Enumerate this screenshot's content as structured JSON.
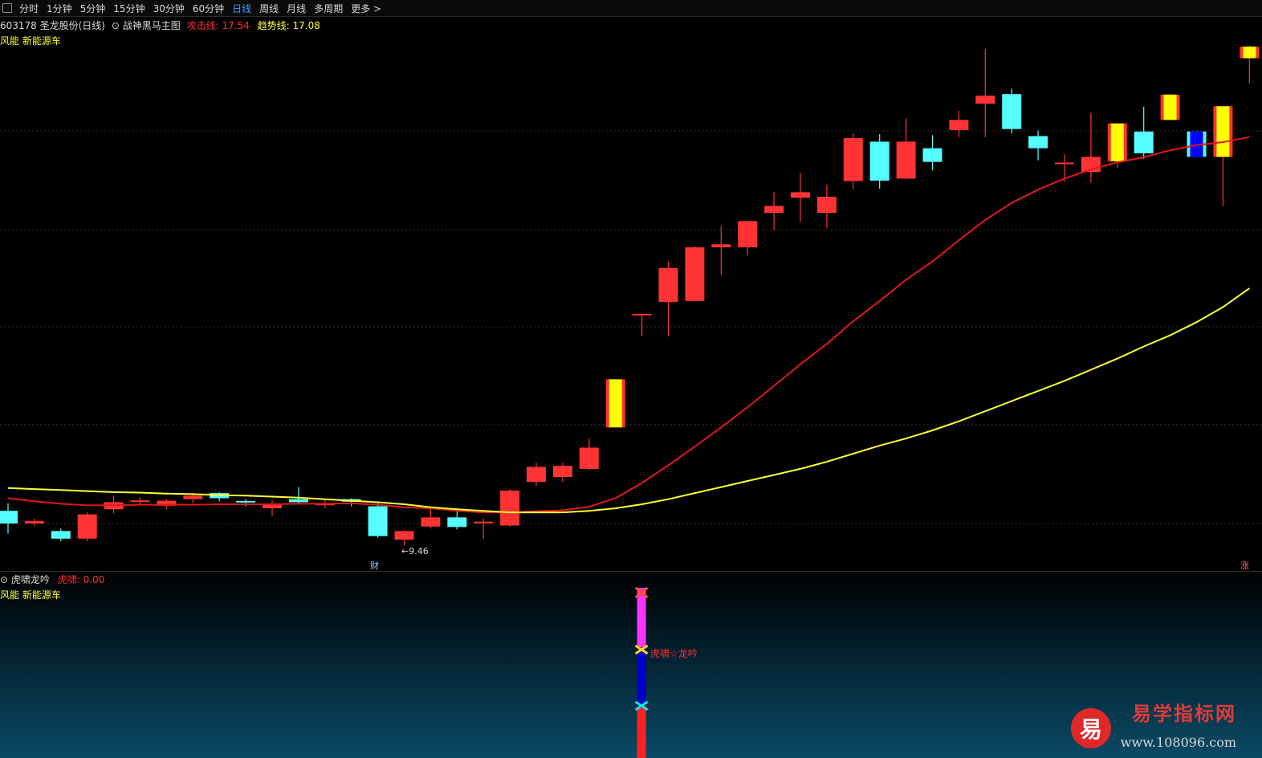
{
  "toolbar": {
    "tabs": [
      "分时",
      "1分钟",
      "5分钟",
      "15分钟",
      "30分钟",
      "60分钟",
      "日线",
      "周线",
      "月线",
      "多周期",
      "更多 >"
    ],
    "active": "日线"
  },
  "main": {
    "stock": "603178 圣龙股份(日线)",
    "indicator": "战神黑马主图",
    "attack_label": "攻击线:",
    "attack_value": "17.54",
    "trend_label": "趋势线:",
    "trend_value": "17.08",
    "concepts": "风能 新能源车",
    "low_mark": "←9.46",
    "cai_badge": "财",
    "zhang_badge": "涨"
  },
  "sub": {
    "indicator": "虎啸龙吟",
    "value_label": "虎啸:",
    "value": "0.00",
    "concepts": "风能 新能源车",
    "signal_text": "虎啸☆龙吟"
  },
  "watermark": {
    "name": "易学指标网",
    "url": "www.108096.com",
    "logo_char": "易"
  },
  "colors": {
    "up": "#ff3333",
    "down": "#55ffff",
    "attack_line": "#e01818",
    "trend_line": "#ffff33",
    "special": "#ffff00",
    "blue": "#0000ff",
    "active_tab": "#3ea1ff"
  },
  "chart_data": {
    "type": "candlestick",
    "note_price_low": 9.46,
    "candles": [
      {
        "o": 10.15,
        "c": 9.9,
        "h": 10.3,
        "l": 9.7
      },
      {
        "o": 9.9,
        "c": 9.95,
        "h": 10.0,
        "l": 9.85
      },
      {
        "o": 9.75,
        "c": 9.6,
        "h": 9.8,
        "l": 9.55
      },
      {
        "o": 9.6,
        "c": 10.08,
        "h": 10.12,
        "l": 9.55
      },
      {
        "o": 10.18,
        "c": 10.32,
        "h": 10.45,
        "l": 10.1
      },
      {
        "o": 10.32,
        "c": 10.34,
        "h": 10.42,
        "l": 10.26
      },
      {
        "o": 10.25,
        "c": 10.35,
        "h": 10.38,
        "l": 10.18
      },
      {
        "o": 10.38,
        "c": 10.45,
        "h": 10.5,
        "l": 10.3
      },
      {
        "o": 10.5,
        "c": 10.4,
        "h": 10.52,
        "l": 10.34
      },
      {
        "o": 10.33,
        "c": 10.3,
        "h": 10.38,
        "l": 10.24
      },
      {
        "o": 10.2,
        "c": 10.28,
        "h": 10.36,
        "l": 10.05
      },
      {
        "o": 10.38,
        "c": 10.32,
        "h": 10.62,
        "l": 10.28
      },
      {
        "o": 10.26,
        "c": 10.3,
        "h": 10.38,
        "l": 10.2
      },
      {
        "o": 10.38,
        "c": 10.33,
        "h": 10.4,
        "l": 10.24
      },
      {
        "o": 10.24,
        "c": 9.65,
        "h": 10.3,
        "l": 9.62
      },
      {
        "o": 9.58,
        "c": 9.75,
        "h": 9.76,
        "l": 9.46
      },
      {
        "o": 9.84,
        "c": 10.02,
        "h": 10.25,
        "l": 9.8
      },
      {
        "o": 10.02,
        "c": 9.83,
        "h": 10.2,
        "l": 9.78
      },
      {
        "o": 9.9,
        "c": 9.92,
        "h": 10.0,
        "l": 9.6
      },
      {
        "o": 9.86,
        "c": 10.55,
        "h": 10.58,
        "l": 9.84
      },
      {
        "o": 10.72,
        "c": 11.02,
        "h": 11.1,
        "l": 10.65
      },
      {
        "o": 10.82,
        "c": 11.04,
        "h": 11.1,
        "l": 10.72
      },
      {
        "o": 10.98,
        "c": 11.4,
        "h": 11.58,
        "l": 10.96
      },
      {
        "o": 11.8,
        "c": 12.75,
        "h": 12.75,
        "l": 11.8,
        "special": "yellow"
      },
      {
        "o": 14.03,
        "c": 14.03,
        "h": 14.03,
        "l": 13.6
      },
      {
        "o": 14.28,
        "c": 14.95,
        "h": 15.08,
        "l": 13.6
      },
      {
        "o": 14.3,
        "c": 15.36,
        "h": 15.38,
        "l": 14.3
      },
      {
        "o": 15.36,
        "c": 15.42,
        "h": 15.78,
        "l": 14.82
      },
      {
        "o": 15.36,
        "c": 15.88,
        "h": 15.88,
        "l": 15.2
      },
      {
        "o": 16.04,
        "c": 16.18,
        "h": 16.45,
        "l": 15.7
      },
      {
        "o": 16.34,
        "c": 16.45,
        "h": 16.83,
        "l": 15.86
      },
      {
        "o": 16.04,
        "c": 16.36,
        "h": 16.6,
        "l": 15.75
      },
      {
        "o": 16.67,
        "c": 17.52,
        "h": 17.62,
        "l": 16.52
      },
      {
        "o": 17.45,
        "c": 16.68,
        "h": 17.6,
        "l": 16.52
      },
      {
        "o": 16.72,
        "c": 17.45,
        "h": 17.92,
        "l": 16.72
      },
      {
        "o": 17.32,
        "c": 17.05,
        "h": 17.58,
        "l": 16.88
      },
      {
        "o": 17.68,
        "c": 17.88,
        "h": 18.06,
        "l": 17.54
      },
      {
        "o": 18.2,
        "c": 18.36,
        "h": 19.28,
        "l": 17.54
      },
      {
        "o": 18.39,
        "c": 17.7,
        "h": 18.5,
        "l": 17.61
      },
      {
        "o": 17.56,
        "c": 17.32,
        "h": 17.67,
        "l": 17.08
      },
      {
        "o": 17.02,
        "c": 17.02,
        "h": 17.2,
        "l": 16.66
      },
      {
        "o": 16.85,
        "c": 17.15,
        "h": 18.02,
        "l": 16.64
      },
      {
        "o": 17.06,
        "c": 17.81,
        "h": 17.81,
        "l": 16.93,
        "special": "yellow"
      },
      {
        "o": 17.65,
        "c": 17.22,
        "h": 18.14,
        "l": 17.11
      },
      {
        "o": 17.88,
        "c": 18.38,
        "h": 18.38,
        "l": 17.88,
        "special": "yellow"
      },
      {
        "o": 17.65,
        "c": 17.15,
        "h": 17.65,
        "l": 17.15,
        "special": "blue"
      },
      {
        "o": 17.15,
        "c": 18.15,
        "h": 18.15,
        "l": 16.17,
        "special": "yellow"
      },
      {
        "o": 19.1,
        "c": 19.33,
        "h": 19.35,
        "l": 18.6,
        "special": "yellow"
      }
    ],
    "attack_line": [
      10.4,
      10.34,
      10.29,
      10.26,
      10.26,
      10.27,
      10.27,
      10.27,
      10.28,
      10.28,
      10.28,
      10.29,
      10.29,
      10.3,
      10.27,
      10.22,
      10.2,
      10.15,
      10.12,
      10.12,
      10.14,
      10.16,
      10.23,
      10.4,
      10.7,
      11.05,
      11.42,
      11.8,
      12.2,
      12.62,
      13.05,
      13.45,
      13.9,
      14.3,
      14.72,
      15.08,
      15.5,
      15.9,
      16.24,
      16.5,
      16.72,
      16.9,
      17.04,
      17.14,
      17.28,
      17.38,
      17.44,
      17.54
    ],
    "trend_line": [
      10.6,
      10.58,
      10.56,
      10.54,
      10.52,
      10.51,
      10.49,
      10.48,
      10.46,
      10.45,
      10.43,
      10.41,
      10.38,
      10.35,
      10.32,
      10.28,
      10.22,
      10.18,
      10.15,
      10.12,
      10.12,
      10.12,
      10.15,
      10.2,
      10.28,
      10.38,
      10.5,
      10.62,
      10.74,
      10.86,
      10.98,
      11.12,
      11.28,
      11.44,
      11.58,
      11.74,
      11.92,
      12.12,
      12.32,
      12.52,
      12.72,
      12.94,
      13.16,
      13.4,
      13.62,
      13.88,
      14.18,
      14.55
    ],
    "ylim": [
      9.2,
      19.6
    ],
    "grid": true
  }
}
